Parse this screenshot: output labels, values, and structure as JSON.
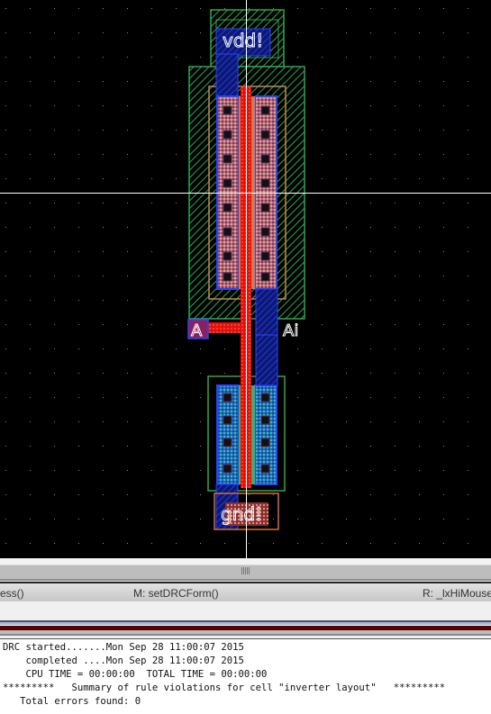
{
  "layout_canvas": {
    "background": "#000000",
    "labels": {
      "vdd": "vdd!",
      "gnd": "gnd!",
      "input": "A",
      "output": "Ai"
    },
    "layer_colors": {
      "nwell": "#2fa84f",
      "pimplant": "#c88a4a",
      "pdiff": "#e09070",
      "ndiff": "#2f9fa0",
      "poly": "#e01010",
      "metal1": "#1a2fe0",
      "contact": "#111111",
      "crosshair": "#ffffff"
    }
  },
  "status_bar": {
    "left": "ess()",
    "middle": "M: setDRCForm()",
    "right": "R: _lxHiMouse"
  },
  "console": {
    "lines": [
      "DRC started.......Mon Sep 28 11:00:07 2015",
      "    completed ....Mon Sep 28 11:00:07 2015",
      "    CPU TIME = 00:00:00  TOTAL TIME = 00:00:00",
      "*********   Summary of rule violations for cell \"inverter layout\"   *********",
      "   Total errors found: 0"
    ]
  }
}
